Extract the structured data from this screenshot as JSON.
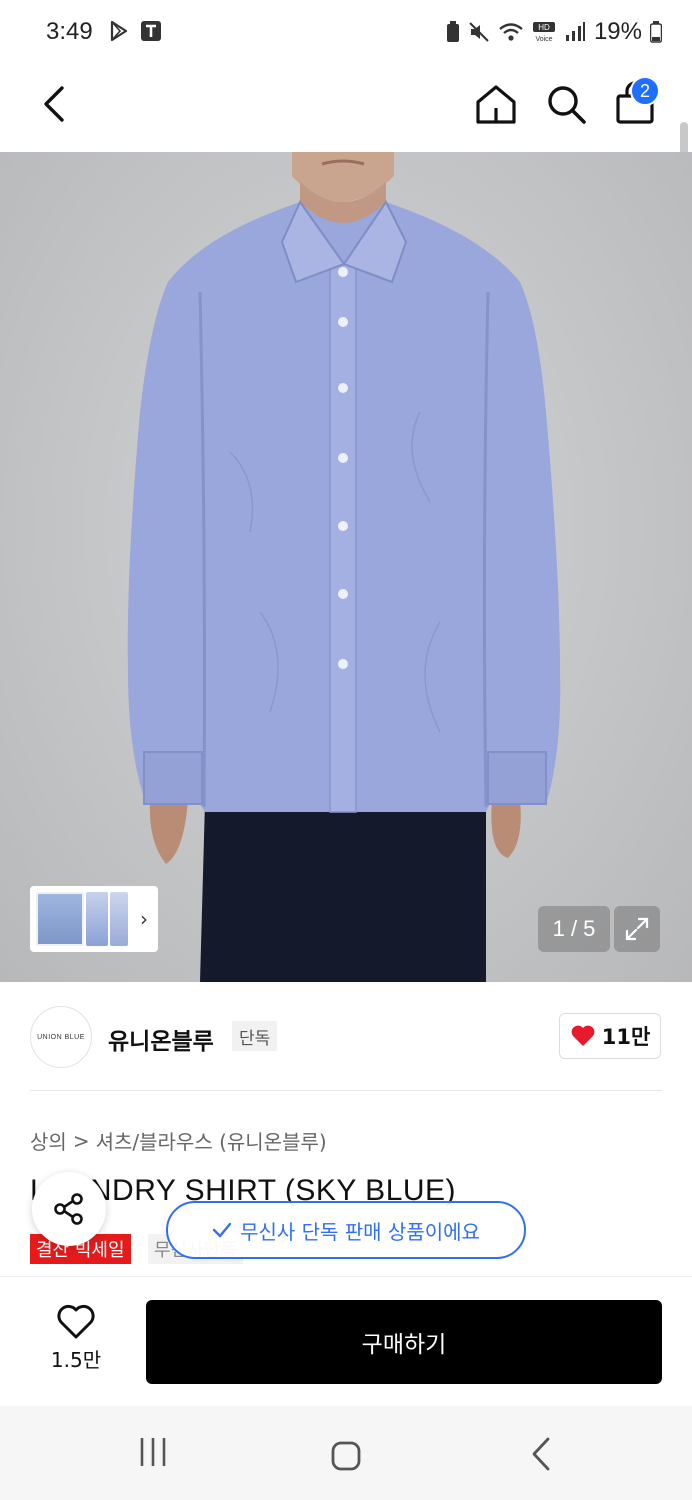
{
  "status_bar": {
    "time": "3:49",
    "battery": "19%"
  },
  "nav": {
    "cart_count": "2"
  },
  "gallery": {
    "counter": "1 / 5"
  },
  "brand": {
    "logo_text": "UNION BLUE",
    "name": "유니온블루",
    "tag": "단독",
    "likes": "11만"
  },
  "breadcrumb": {
    "category": "상의",
    "separator": ">",
    "subcategory": "셔츠/블라우스 (유니온블루)"
  },
  "product": {
    "title": "LAUNDRY SHIRT (SKY BLUE)",
    "badge_sale": "결산 빅세일",
    "badge_exclusive": "무신사단독"
  },
  "toast": {
    "text": "무신사 단독 판매 상품이에요"
  },
  "bottom_bar": {
    "wish_count": "1.5만",
    "buy_label": "구매하기"
  },
  "colors": {
    "accent_blue": "#2f6ff0",
    "sale_red": "#e51b1b",
    "heart_red": "#e8192c",
    "badge_blue": "#1f6fff"
  }
}
